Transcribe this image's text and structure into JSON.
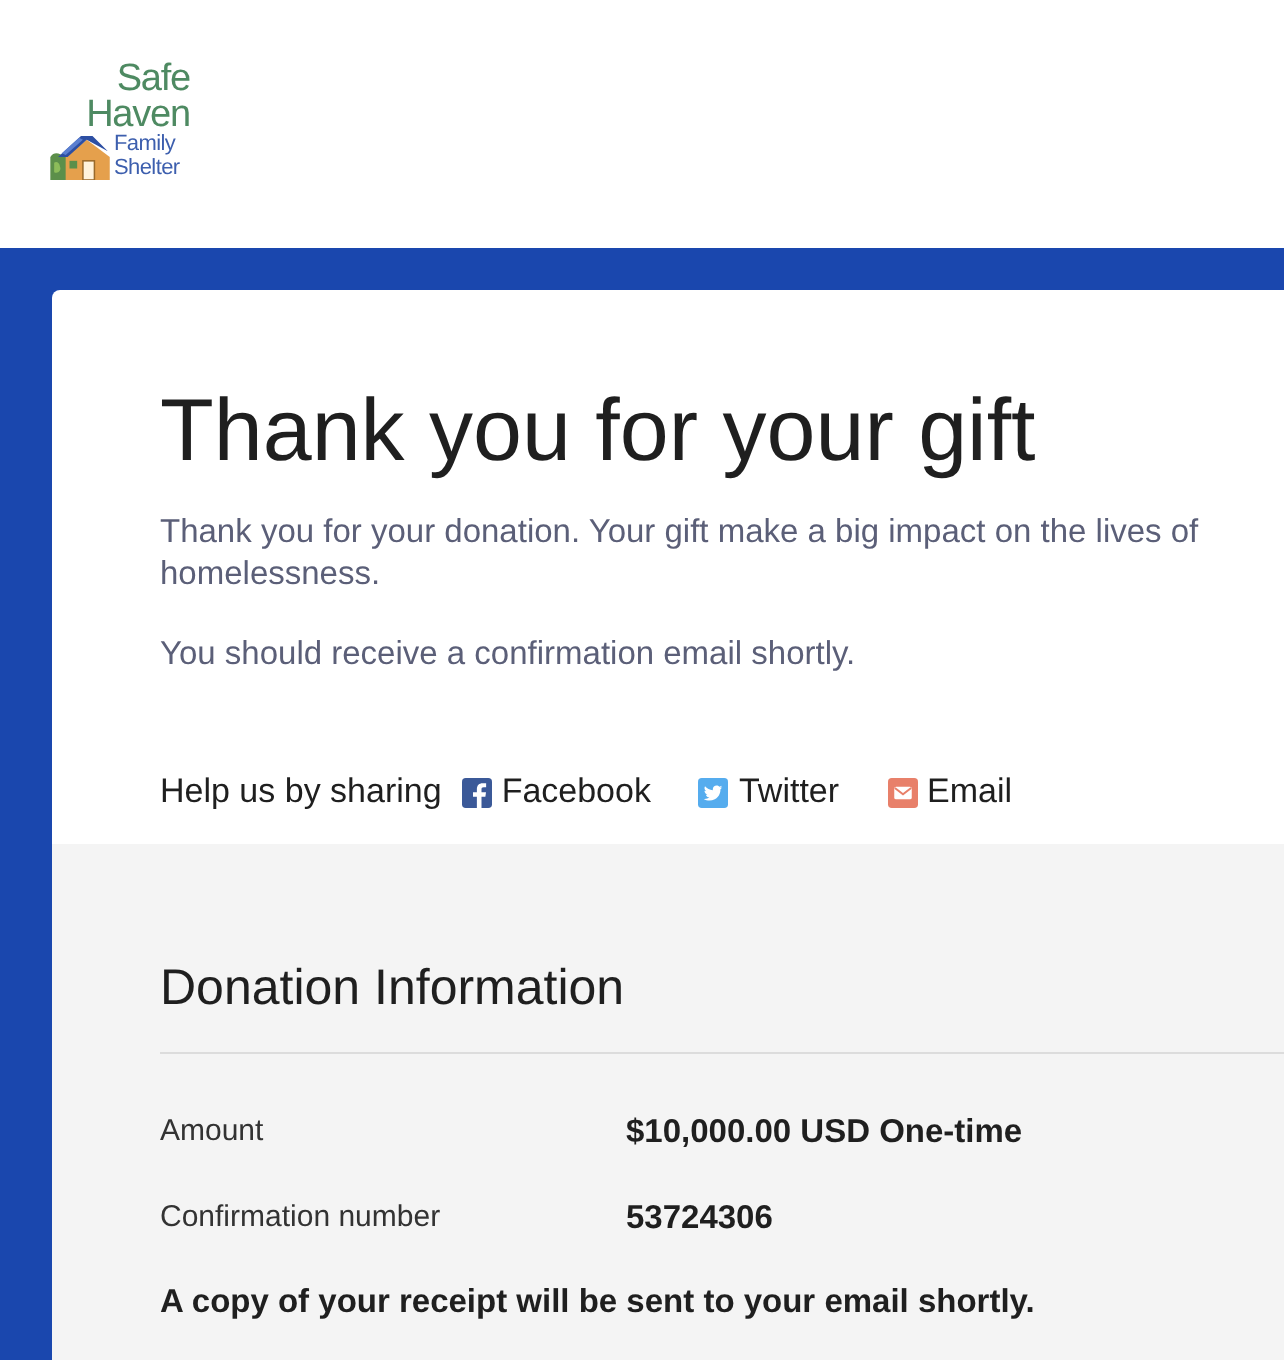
{
  "logo": {
    "title_lines": [
      "Safe",
      "Haven"
    ],
    "subtitle_lines": [
      "Family",
      "Shelter"
    ]
  },
  "thank_you": {
    "title": "Thank you for your gift",
    "message_lines": [
      "Thank you for your donation. Your gift make a big impact on the lives of",
      "homelessness."
    ],
    "confirmation_note": "You should receive a confirmation email shortly."
  },
  "share": {
    "label": "Help us by sharing",
    "links": [
      {
        "kind": "facebook",
        "label": "Facebook"
      },
      {
        "kind": "twitter",
        "label": "Twitter"
      },
      {
        "kind": "email",
        "label": "Email"
      }
    ]
  },
  "donation_info": {
    "title": "Donation Information",
    "rows": [
      {
        "label": "Amount",
        "value": "$10,000.00 USD One-time"
      },
      {
        "label": "Confirmation number",
        "value": "53724306"
      }
    ],
    "note": "A copy of your receipt will be sent to your email shortly."
  }
}
